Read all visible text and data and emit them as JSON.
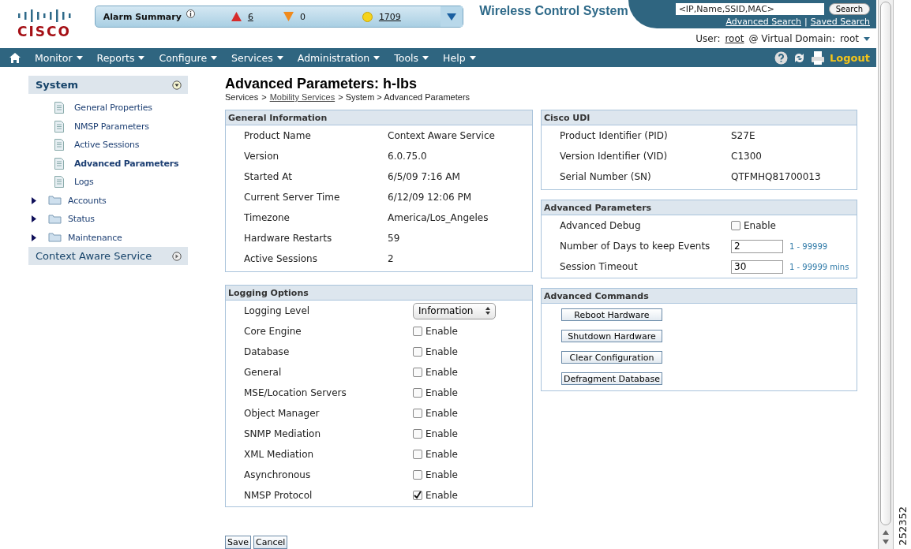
{
  "header": {
    "alarm_summary": {
      "label": "Alarm Summary",
      "counts": [
        {
          "kind": "critical",
          "value": "6",
          "link": true
        },
        {
          "kind": "major",
          "value": "0",
          "link": false
        },
        {
          "kind": "minor",
          "value": "1709",
          "link": true
        }
      ]
    },
    "title": "Wireless Control System",
    "search": {
      "placeholder": "<IP,Name,SSID,MAC>",
      "button": "Search"
    },
    "links": [
      "Advanced Search",
      "|",
      "Saved Search"
    ],
    "user": {
      "label": "User:",
      "name": "root",
      "domain_label": "@ Virtual Domain:",
      "domain": "root"
    }
  },
  "nav": {
    "menus": [
      "Monitor",
      "Reports",
      "Configure",
      "Services",
      "Administration",
      "Tools",
      "Help"
    ],
    "logout": "Logout"
  },
  "sidebar": {
    "sections": [
      {
        "title": "System",
        "expanded": true,
        "items": [
          {
            "kind": "page",
            "label": "General Properties",
            "selected": false
          },
          {
            "kind": "page",
            "label": "NMSP Parameters",
            "selected": false
          },
          {
            "kind": "page",
            "label": "Active Sessions",
            "selected": false
          },
          {
            "kind": "page",
            "label": "Advanced Parameters",
            "selected": true
          },
          {
            "kind": "page",
            "label": "Logs",
            "selected": false
          },
          {
            "kind": "folder",
            "label": "Accounts",
            "selected": false,
            "expanded": false
          },
          {
            "kind": "folder",
            "label": "Status",
            "selected": false,
            "expanded": false
          },
          {
            "kind": "folder",
            "label": "Maintenance",
            "selected": false,
            "expanded": false
          }
        ]
      },
      {
        "title": "Context Aware Service",
        "expanded": false
      }
    ]
  },
  "page": {
    "title": "Advanced Parameters: h-lbs",
    "breadcrumb": [
      {
        "label": "Services",
        "link": false
      },
      {
        "label": ">",
        "link": false
      },
      {
        "label": "Mobility Services",
        "link": true
      },
      {
        "label": "> System > Advanced Parameters",
        "link": false
      }
    ]
  },
  "general_information": {
    "title": "General Information",
    "rows": [
      {
        "label": "Product Name",
        "value": "Context Aware Service"
      },
      {
        "label": "Version",
        "value": "6.0.75.0"
      },
      {
        "label": "Started At",
        "value": "6/5/09 7:16 AM"
      },
      {
        "label": "Current Server Time",
        "value": "6/12/09 12:06 PM"
      },
      {
        "label": "Timezone",
        "value": "America/Los_Angeles"
      },
      {
        "label": "Hardware Restarts",
        "value": "59"
      },
      {
        "label": "Active Sessions",
        "value": "2"
      }
    ]
  },
  "logging_options": {
    "title": "Logging Options",
    "rows": [
      {
        "kind": "select",
        "label": "Logging Level",
        "value": "Information"
      },
      {
        "kind": "checkbox",
        "label": "Core Engine",
        "option": "Enable",
        "checked": false
      },
      {
        "kind": "checkbox",
        "label": "Database",
        "option": "Enable",
        "checked": false
      },
      {
        "kind": "checkbox",
        "label": "General",
        "option": "Enable",
        "checked": false
      },
      {
        "kind": "checkbox",
        "label": "MSE/Location Servers",
        "option": "Enable",
        "checked": false
      },
      {
        "kind": "checkbox",
        "label": "Object Manager",
        "option": "Enable",
        "checked": false
      },
      {
        "kind": "checkbox",
        "label": "SNMP Mediation",
        "option": "Enable",
        "checked": false
      },
      {
        "kind": "checkbox",
        "label": "XML Mediation",
        "option": "Enable",
        "checked": false
      },
      {
        "kind": "checkbox",
        "label": "Asynchronous",
        "option": "Enable",
        "checked": false
      },
      {
        "kind": "checkbox",
        "label": "NMSP Protocol",
        "option": "Enable",
        "checked": true
      }
    ]
  },
  "form_buttons": [
    "Save",
    "Cancel"
  ],
  "cisco_udi": {
    "title": "Cisco UDI",
    "rows": [
      {
        "label": "Product Identifier (PID)",
        "value": "S27E"
      },
      {
        "label": "Version Identifier (VID)",
        "value": "C1300"
      },
      {
        "label": "Serial Number (SN)",
        "value": "QTFMHQ81700013"
      }
    ]
  },
  "advanced_parameters": {
    "title": "Advanced Parameters",
    "rows": [
      {
        "kind": "checkbox",
        "label": "Advanced Debug",
        "option": "Enable",
        "checked": false
      },
      {
        "kind": "input",
        "label": "Number of Days to keep Events",
        "value": "2",
        "hint": "1 - 99999"
      },
      {
        "kind": "input",
        "label": "Session Timeout",
        "value": "30",
        "hint": "1 - 99999 mins"
      }
    ]
  },
  "advanced_commands": {
    "title": "Advanced Commands",
    "buttons": [
      "Reboot Hardware",
      "Shutdown Hardware",
      "Clear Configuration",
      "Defragment Database"
    ]
  },
  "logo": "CISCO",
  "figure_number": "252352"
}
